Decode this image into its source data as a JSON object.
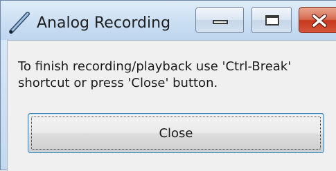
{
  "window": {
    "title": "Analog Recording",
    "app_icon": "pen-icon"
  },
  "caption_buttons": {
    "minimize": "minimize-icon",
    "maximize": "maximize-icon",
    "close": "close-icon",
    "close_accent": "#c7391f"
  },
  "dialog": {
    "message_line1": "To finish recording/playback use 'Ctrl-Break'",
    "message_line2": "shortcut or press 'Close' button.",
    "close_label": "Close",
    "focus_border": "#3c7fb1"
  }
}
